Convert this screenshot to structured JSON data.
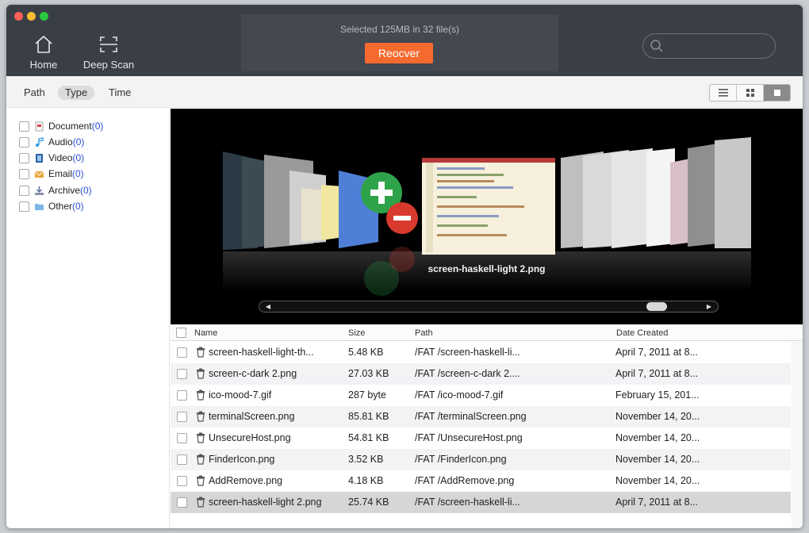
{
  "toolbar": {
    "home_label": "Home",
    "deepscan_label": "Deep Scan",
    "status_text": "Selected 125MB in 32 file(s)",
    "recover_label": "Reocver",
    "search_placeholder": ""
  },
  "filters": {
    "tabs": [
      {
        "label": "Path"
      },
      {
        "label": "Type"
      },
      {
        "label": "Time"
      }
    ],
    "active_tab": "Type"
  },
  "view_modes": [
    "list-view-icon",
    "grid-view-icon",
    "coverflow-view-icon"
  ],
  "categories": [
    {
      "name": "Document",
      "count": "(0)",
      "icon": "document-icon"
    },
    {
      "name": "Audio",
      "count": "(0)",
      "icon": "audio-icon"
    },
    {
      "name": "Video",
      "count": "(0)",
      "icon": "video-icon"
    },
    {
      "name": "Email",
      "count": "(0)",
      "icon": "email-icon"
    },
    {
      "name": "Archive",
      "count": "(0)",
      "icon": "archive-icon"
    },
    {
      "name": "Other",
      "count": "(0)",
      "icon": "folder-icon"
    }
  ],
  "preview": {
    "caption": "screen-haskell-light 2.png"
  },
  "table": {
    "headers": {
      "name": "Name",
      "size": "Size",
      "path": "Path",
      "date": "Date Created"
    },
    "rows": [
      {
        "name": "screen-haskell-light-th...",
        "size": "5.48 KB",
        "path": "/FAT /screen-haskell-li...",
        "date": "April 7, 2011 at 8..."
      },
      {
        "name": "screen-c-dark 2.png",
        "size": "27.03 KB",
        "path": "/FAT /screen-c-dark 2....",
        "date": "April 7, 2011 at 8..."
      },
      {
        "name": "ico-mood-7.gif",
        "size": "287 byte",
        "path": "/FAT /ico-mood-7.gif",
        "date": "February 15, 201..."
      },
      {
        "name": "terminalScreen.png",
        "size": "85.81 KB",
        "path": "/FAT /terminalScreen.png",
        "date": "November 14, 20..."
      },
      {
        "name": "UnsecureHost.png",
        "size": "54.81 KB",
        "path": "/FAT /UnsecureHost.png",
        "date": "November 14, 20..."
      },
      {
        "name": "FinderIcon.png",
        "size": "3.52 KB",
        "path": "/FAT /FinderIcon.png",
        "date": "November 14, 20..."
      },
      {
        "name": "AddRemove.png",
        "size": "4.18 KB",
        "path": "/FAT /AddRemove.png",
        "date": "November 14, 20..."
      },
      {
        "name": "screen-haskell-light 2.png",
        "size": "25.74 KB",
        "path": "/FAT /screen-haskell-li...",
        "date": "April 7, 2011 at 8..."
      }
    ],
    "selected_index": 7
  },
  "colors": {
    "toolbar_bg": "#3a3f47",
    "recover_button": "#f46a2f",
    "count_link": "#2a4fd4"
  }
}
